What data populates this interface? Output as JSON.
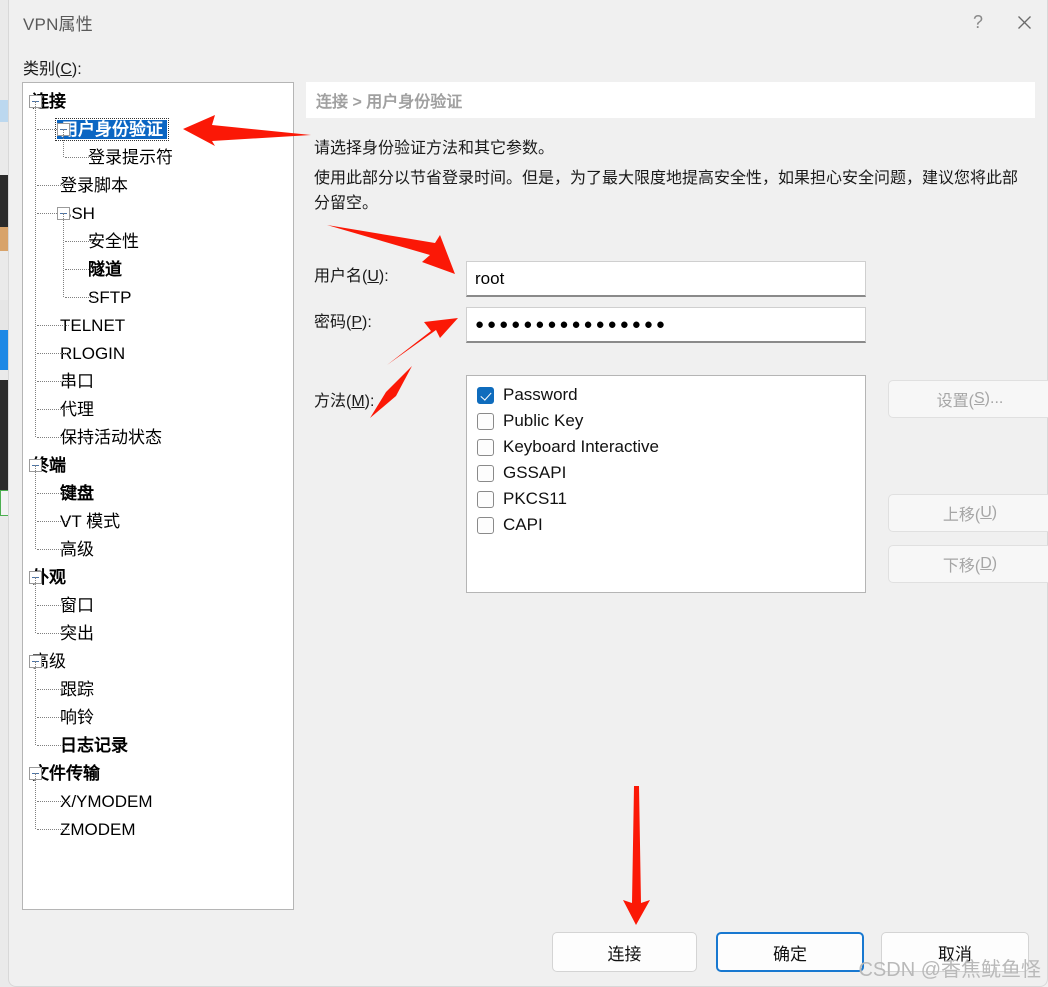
{
  "window": {
    "title": "VPN属性",
    "help_icon": "question-mark-icon",
    "close_icon": "close-icon"
  },
  "category": {
    "label_prefix": "类别(",
    "label_key": "C",
    "label_suffix": "):"
  },
  "tree": {
    "selected": "用户身份验证",
    "items": [
      {
        "label": "连接",
        "level": 0,
        "bold": true,
        "expander": true,
        "selected": false
      },
      {
        "label": "用户身份验证",
        "level": 1,
        "bold": true,
        "expander": true,
        "selected": true
      },
      {
        "label": "登录提示符",
        "level": 2,
        "bold": false,
        "expander": false,
        "selected": false
      },
      {
        "label": "登录脚本",
        "level": 1,
        "bold": false,
        "expander": false,
        "selected": false
      },
      {
        "label": "SSH",
        "level": 1,
        "bold": false,
        "expander": true,
        "selected": false
      },
      {
        "label": "安全性",
        "level": 2,
        "bold": false,
        "expander": false,
        "selected": false
      },
      {
        "label": "隧道",
        "level": 2,
        "bold": true,
        "expander": false,
        "selected": false
      },
      {
        "label": "SFTP",
        "level": 2,
        "bold": false,
        "expander": false,
        "selected": false
      },
      {
        "label": "TELNET",
        "level": 1,
        "bold": false,
        "expander": false,
        "selected": false
      },
      {
        "label": "RLOGIN",
        "level": 1,
        "bold": false,
        "expander": false,
        "selected": false
      },
      {
        "label": "串口",
        "level": 1,
        "bold": false,
        "expander": false,
        "selected": false
      },
      {
        "label": "代理",
        "level": 1,
        "bold": false,
        "expander": false,
        "selected": false
      },
      {
        "label": "保持活动状态",
        "level": 1,
        "bold": false,
        "expander": false,
        "selected": false
      },
      {
        "label": "终端",
        "level": 0,
        "bold": true,
        "expander": true,
        "selected": false
      },
      {
        "label": "键盘",
        "level": 1,
        "bold": true,
        "expander": false,
        "selected": false
      },
      {
        "label": "VT 模式",
        "level": 1,
        "bold": false,
        "expander": false,
        "selected": false
      },
      {
        "label": "高级",
        "level": 1,
        "bold": false,
        "expander": false,
        "selected": false
      },
      {
        "label": "外观",
        "level": 0,
        "bold": true,
        "expander": true,
        "selected": false
      },
      {
        "label": "窗口",
        "level": 1,
        "bold": false,
        "expander": false,
        "selected": false
      },
      {
        "label": "突出",
        "level": 1,
        "bold": false,
        "expander": false,
        "selected": false
      },
      {
        "label": "高级",
        "level": 0,
        "bold": false,
        "expander": true,
        "selected": false
      },
      {
        "label": "跟踪",
        "level": 1,
        "bold": false,
        "expander": false,
        "selected": false
      },
      {
        "label": "响铃",
        "level": 1,
        "bold": false,
        "expander": false,
        "selected": false
      },
      {
        "label": "日志记录",
        "level": 1,
        "bold": true,
        "expander": false,
        "selected": false
      },
      {
        "label": "文件传输",
        "level": 0,
        "bold": true,
        "expander": true,
        "selected": false
      },
      {
        "label": "X/YMODEM",
        "level": 1,
        "bold": false,
        "expander": false,
        "selected": false
      },
      {
        "label": "ZMODEM",
        "level": 1,
        "bold": false,
        "expander": false,
        "selected": false
      }
    ]
  },
  "panel": {
    "breadcrumb": "连接 > 用户身份验证",
    "description_1": "请选择身份验证方法和其它参数。",
    "description_2": "使用此部分以节省登录时间。但是，为了最大限度地提高安全性，如果担心安全问题，建议您将此部分留空。",
    "username": {
      "label_prefix": "用户名(",
      "label_key": "U",
      "label_suffix": "):",
      "value": "root",
      "placeholder": ""
    },
    "password": {
      "label_prefix": "密码(",
      "label_key": "P",
      "label_suffix": "):",
      "value": "●●●●●●●●●●●●●●●●",
      "placeholder": ""
    },
    "methods": {
      "label_prefix": "方法(",
      "label_key": "M",
      "label_suffix": "):",
      "items": [
        {
          "label": "Password",
          "checked": true
        },
        {
          "label": "Public Key",
          "checked": false
        },
        {
          "label": "Keyboard Interactive",
          "checked": false
        },
        {
          "label": "GSSAPI",
          "checked": false
        },
        {
          "label": "PKCS11",
          "checked": false
        },
        {
          "label": "CAPI",
          "checked": false
        }
      ]
    },
    "side_buttons": [
      {
        "prefix": "设置(",
        "key": "S",
        "suffix": ")...",
        "enabled": false
      },
      {
        "prefix": "上移(",
        "key": "U",
        "suffix": ")",
        "enabled": false
      },
      {
        "prefix": "下移(",
        "key": "D",
        "suffix": ")",
        "enabled": false
      }
    ]
  },
  "footer": {
    "connect_label": "连接",
    "ok_label": "确定",
    "cancel_label": "取消"
  },
  "watermark": "CSDN @香焦鱿鱼怪",
  "colors": {
    "accent": "#0f6cbd",
    "selection": "#0b66c3",
    "primary_border": "#1878d0",
    "annotation_arrow": "#fb1806",
    "dialog_bg": "#f0f0f0",
    "field_bg": "#ffffff",
    "disabled_text": "#a6a6a6"
  },
  "annotations": [
    {
      "name": "arrow-to-tree-selection",
      "color": "#fb1806"
    },
    {
      "name": "arrow-to-username-field",
      "color": "#fb1806"
    },
    {
      "name": "arrow-to-password-field",
      "color": "#fb1806"
    },
    {
      "name": "arrow-to-connect-button",
      "color": "#fb1806"
    }
  ]
}
